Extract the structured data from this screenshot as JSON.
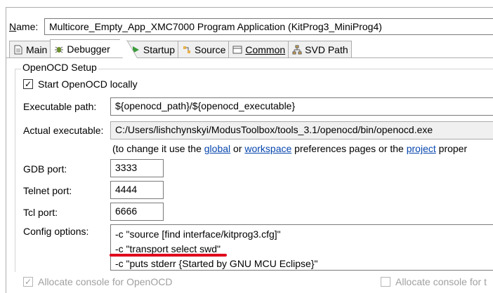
{
  "header": {
    "name_label": "Name:",
    "name_value": "Multicore_Empty_App_XMC7000 Program Application (KitProg3_MiniProg4)"
  },
  "tabs": [
    {
      "label": "Main",
      "icon": "page-icon"
    },
    {
      "label": "Debugger",
      "icon": "bug-icon"
    },
    {
      "label": "Startup",
      "icon": "play-icon"
    },
    {
      "label": "Source",
      "icon": "source-icon"
    },
    {
      "label": "Common",
      "icon": "common-icon"
    },
    {
      "label": "SVD Path",
      "icon": "tree-icon"
    }
  ],
  "openocd": {
    "group_title": "OpenOCD Setup",
    "start_locally_label": "Start OpenOCD locally",
    "start_locally_checked": true,
    "executable_path_label": "Executable path:",
    "executable_path_value": "${openocd_path}/${openocd_executable}",
    "actual_executable_label": "Actual executable:",
    "actual_executable_value": "C:/Users/lishchynskyi/ModusToolbox/tools_3.1/openocd/bin/openocd.exe",
    "hint_prefix": "(to change it use the ",
    "hint_link_global": "global",
    "hint_or": " or ",
    "hint_link_workspace": "workspace",
    "hint_middle": " preferences pages or the ",
    "hint_link_project": "project",
    "hint_suffix": " proper",
    "gdb_port_label": "GDB port:",
    "gdb_port_value": "3333",
    "telnet_port_label": "Telnet port:",
    "telnet_port_value": "4444",
    "tcl_port_label": "Tcl port:",
    "tcl_port_value": "6666",
    "config_options_label": "Config options:",
    "config_line_1": "-c \"source [find interface/kitprog3.cfg]\"",
    "config_line_2": "-c \"transport select swd\"",
    "config_line_3": "-c \"puts stderr {Started by GNU MCU Eclipse}\"",
    "allocate_console_label": "Allocate console for OpenOCD",
    "allocate_console_right_label": "Allocate console for t"
  },
  "colors": {
    "link": "#0645ad",
    "highlight_underline": "#e0001b"
  }
}
